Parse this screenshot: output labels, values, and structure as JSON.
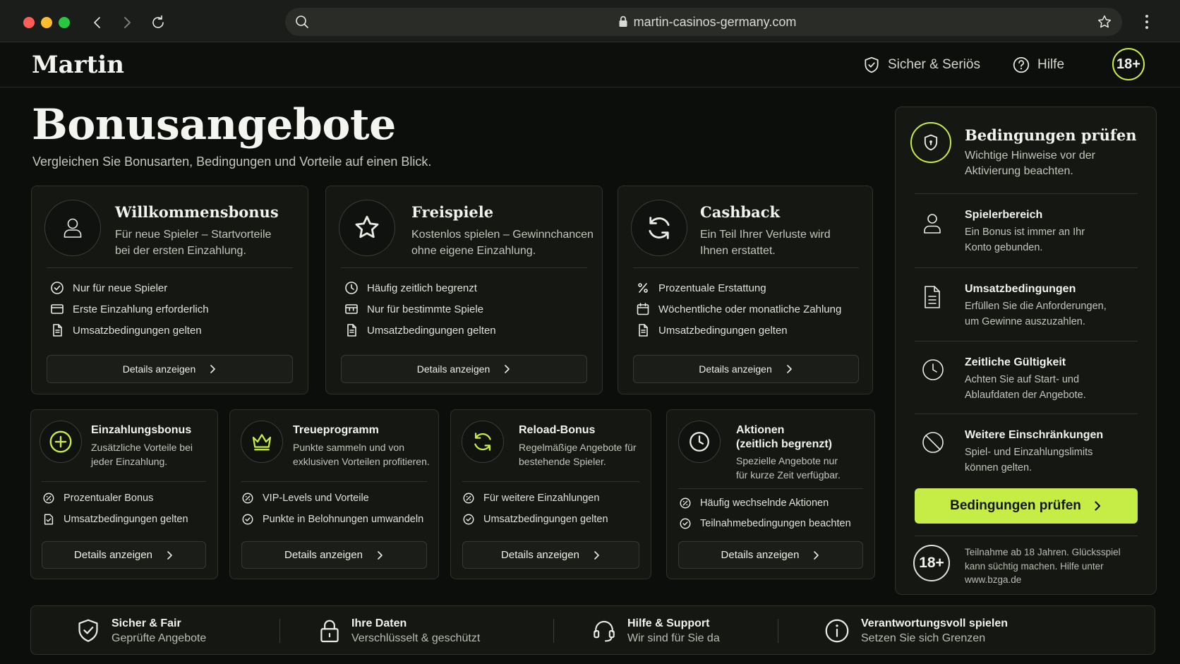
{
  "browser": {
    "url": "martin-casinos-germany.com",
    "traffic_lights": [
      "#ff5f57",
      "#febc2e",
      "#28c840"
    ]
  },
  "header": {
    "logo": "Martin",
    "links": [
      {
        "label": "Sicher & Seriös",
        "icon": "shield-check-icon"
      },
      {
        "label": "Hilfe",
        "icon": "question-circle-icon"
      }
    ],
    "age_badge": "18+"
  },
  "page": {
    "title": "Bonusangebote",
    "subtitle": "Vergleichen Sie Bonusarten, Bedingungen und Vorteile auf einen Blick."
  },
  "accent_color": "#c6ed46",
  "top_cards": [
    {
      "title": "Willkommensbonus",
      "desc_lines": [
        "Für neue Spieler – Startvorteile",
        "bei der ersten Einzahlung."
      ],
      "icon": "user-icon",
      "features": [
        {
          "label": "Nur für neue Spieler",
          "icon": "check-circle-icon"
        },
        {
          "label": "Erste Einzahlung erforderlich",
          "icon": "card-icon"
        },
        {
          "label": "Umsatzbedingungen gelten",
          "icon": "document-icon"
        }
      ],
      "button": "Details anzeigen"
    },
    {
      "title": "Freispiele",
      "desc_lines": [
        "Kostenlos spielen – Gewinnchancen",
        "ohne eigene Einzahlung."
      ],
      "icon": "star-icon",
      "features": [
        {
          "label": "Häufig zeitlich begrenzt",
          "icon": "clock-icon"
        },
        {
          "label": "Nur für bestimmte Spiele",
          "icon": "slot-icon"
        },
        {
          "label": "Umsatzbedingungen gelten",
          "icon": "document-icon"
        }
      ],
      "button": "Details anzeigen"
    },
    {
      "title": "Cashback",
      "desc_lines": [
        "Ein Teil Ihrer Verluste wird",
        "Ihnen erstattet."
      ],
      "icon": "refresh-icon",
      "features": [
        {
          "label": "Prozentuale Erstattung",
          "icon": "percent-icon"
        },
        {
          "label": "Wöchentliche oder monatliche Zahlung",
          "icon": "calendar-icon"
        },
        {
          "label": "Umsatzbedingungen gelten",
          "icon": "document-icon"
        }
      ],
      "button": "Details anzeigen"
    }
  ],
  "bottom_cards": [
    {
      "title_lines": [
        "Einzahlungsbonus"
      ],
      "desc_lines": [
        "Zusätzliche Vorteile bei",
        "jeder Einzahlung."
      ],
      "icon": "plus-circle-icon",
      "features": [
        {
          "label": "Prozentualer Bonus",
          "icon": "percent-badge-icon"
        },
        {
          "label": "Umsatzbedingungen gelten",
          "icon": "document-check-icon"
        }
      ],
      "button": "Details anzeigen"
    },
    {
      "title_lines": [
        "Treueprogramm"
      ],
      "desc_lines": [
        "Punkte sammeln und von",
        "exklusiven Vorteilen profitieren."
      ],
      "icon": "crown-icon",
      "features": [
        {
          "label": "VIP-Levels und Vorteile",
          "icon": "percent-badge-icon"
        },
        {
          "label": "Punkte in Belohnungen umwandeln",
          "icon": "check-badge-icon"
        }
      ],
      "button": "Details anzeigen"
    },
    {
      "title_lines": [
        "Reload-Bonus"
      ],
      "desc_lines": [
        "Regelmäßige Angebote für",
        "bestehende Spieler."
      ],
      "icon": "refresh-icon",
      "features": [
        {
          "label": "Für weitere Einzahlungen",
          "icon": "percent-badge-icon"
        },
        {
          "label": "Umsatzbedingungen gelten",
          "icon": "check-badge-icon"
        }
      ],
      "button": "Details anzeigen"
    },
    {
      "title_lines": [
        "Aktionen",
        "(zeitlich begrenzt)"
      ],
      "desc_lines": [
        "Spezielle Angebote nur",
        "für kurze Zeit verfügbar."
      ],
      "icon": "clock-icon",
      "features": [
        {
          "label": "Häufig wechselnde Aktionen",
          "icon": "percent-badge-icon"
        },
        {
          "label": "Teilnahmebedingungen beachten",
          "icon": "check-badge-icon"
        }
      ],
      "button": "Details anzeigen"
    }
  ],
  "sidebar": {
    "title": "Bedingungen prüfen",
    "subtitle_lines": [
      "Wichtige Hinweise vor der",
      "Aktivierung beachten."
    ],
    "items": [
      {
        "title": "Spielerbereich",
        "desc_lines": [
          "Ein Bonus ist immer an Ihr",
          "Konto gebunden."
        ],
        "icon": "user-icon"
      },
      {
        "title": "Umsatzbedingungen",
        "desc_lines": [
          "Erfüllen Sie die Anforderungen,",
          "um Gewinne auszuzahlen."
        ],
        "icon": "document-icon"
      },
      {
        "title": "Zeitliche Gültigkeit",
        "desc_lines": [
          "Achten Sie auf Start- und",
          "Ablaufdaten der Angebote."
        ],
        "icon": "clock-icon"
      },
      {
        "title": "Weitere Einschränkungen",
        "desc_lines": [
          "Spiel- und Einzahlungslimits",
          "können gelten."
        ],
        "icon": "ban-icon"
      }
    ],
    "cta": "Bedingungen prüfen",
    "age_badge": "18+",
    "disclaimer_lines": [
      "Teilnahme ab 18 Jahren. Glücksspiel",
      "kann süchtig machen. Hilfe unter",
      "www.bzga.de"
    ]
  },
  "footer": [
    {
      "title": "Sicher & Fair",
      "sub": "Geprüfte Angebote",
      "icon": "shield-check-icon"
    },
    {
      "title": "Ihre Daten",
      "sub": "Verschlüsselt & geschützt",
      "icon": "lock-icon"
    },
    {
      "title": "Hilfe & Support",
      "sub": "Wir sind für Sie da",
      "icon": "headset-icon"
    },
    {
      "title": "Verantwortungsvoll spielen",
      "sub": "Setzen Sie sich Grenzen",
      "icon": "info-icon"
    }
  ]
}
